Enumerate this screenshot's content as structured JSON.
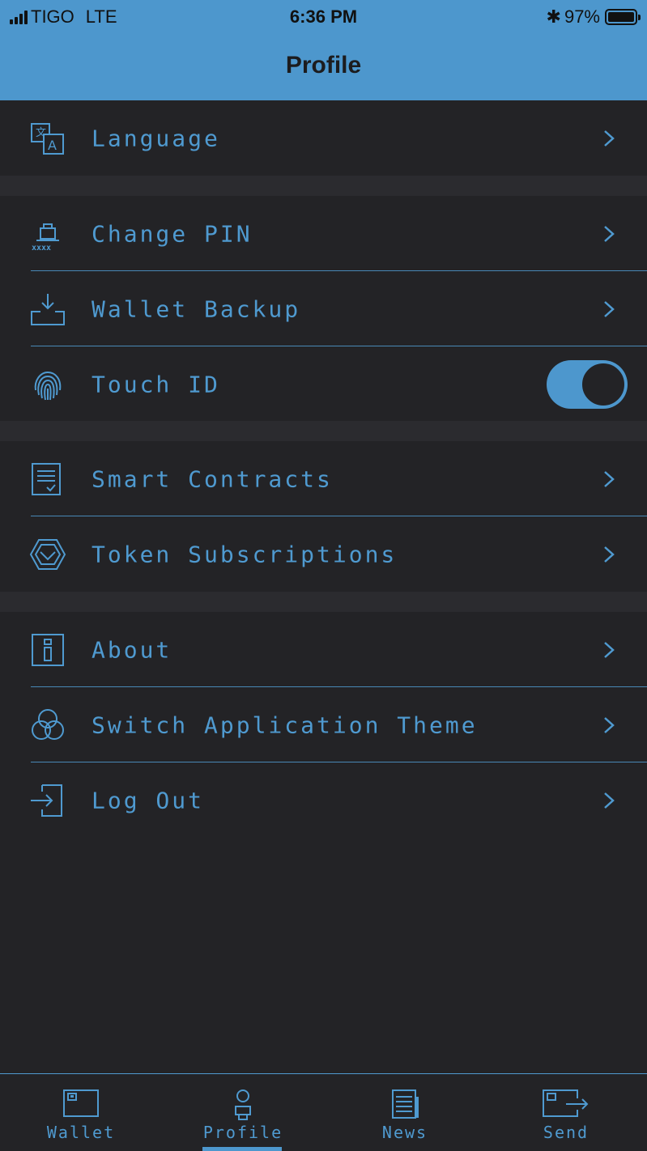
{
  "status_bar": {
    "carrier": "TIGO",
    "network": "LTE",
    "time": "6:36 PM",
    "battery": "97%"
  },
  "header": {
    "title": "Profile"
  },
  "settings": {
    "language": {
      "label": "Language",
      "icon": "translate-icon"
    },
    "change_pin": {
      "label": "Change PIN",
      "icon": "pin-lock-icon"
    },
    "wallet_backup": {
      "label": "Wallet Backup",
      "icon": "download-tray-icon"
    },
    "touch_id": {
      "label": "Touch ID",
      "icon": "fingerprint-icon",
      "enabled": true
    },
    "smart_contracts": {
      "label": "Smart Contracts",
      "icon": "document-check-icon"
    },
    "token_subscriptions": {
      "label": "Token Subscriptions",
      "icon": "hexagon-check-icon"
    },
    "about": {
      "label": "About",
      "icon": "info-icon"
    },
    "switch_theme": {
      "label": "Switch Application Theme",
      "icon": "color-circles-icon"
    },
    "log_out": {
      "label": "Log Out",
      "icon": "logout-icon"
    }
  },
  "tabbar": {
    "tabs": [
      {
        "label": "Wallet",
        "icon": "wallet-icon",
        "active": false
      },
      {
        "label": "Profile",
        "icon": "profile-icon",
        "active": true
      },
      {
        "label": "News",
        "icon": "news-icon",
        "active": false
      },
      {
        "label": "Send",
        "icon": "send-icon",
        "active": false
      }
    ]
  },
  "colors": {
    "accent": "#4d97cd",
    "background": "#232326",
    "section_gap": "#2b2b2f",
    "text_accent": "#4f9ad0"
  }
}
